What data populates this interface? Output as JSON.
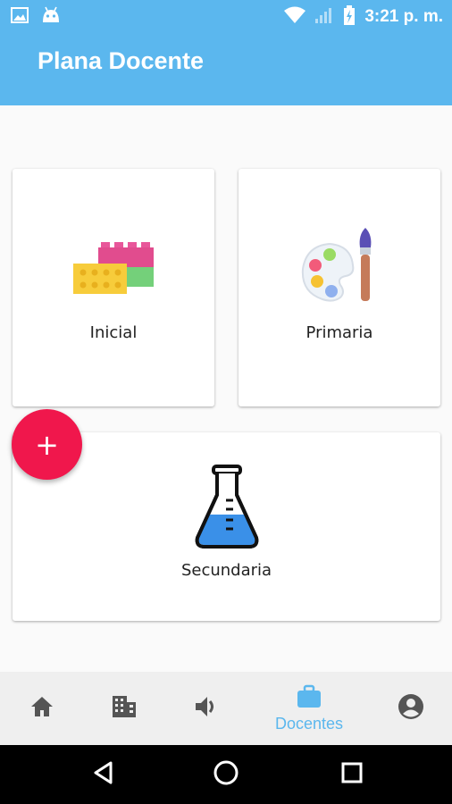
{
  "status_bar": {
    "time": "3:21 p. m.",
    "icons": [
      "image-icon",
      "android-icon",
      "wifi-icon",
      "signal-icon",
      "battery-charging-icon"
    ]
  },
  "app_bar": {
    "title": "Plana Docente"
  },
  "levels": [
    {
      "label": "Inicial",
      "icon": "lego-blocks-icon"
    },
    {
      "label": "Primaria",
      "icon": "paint-palette-icon"
    },
    {
      "label": "Secundaria",
      "icon": "flask-icon"
    }
  ],
  "fab": {
    "label": "+",
    "icon": "add-icon"
  },
  "bottom_nav": {
    "items": [
      {
        "icon": "home-icon",
        "label": ""
      },
      {
        "icon": "building-icon",
        "label": ""
      },
      {
        "icon": "volume-icon",
        "label": ""
      },
      {
        "icon": "briefcase-icon",
        "label": "Docentes",
        "active": true
      },
      {
        "icon": "account-icon",
        "label": ""
      }
    ]
  },
  "system_nav": [
    "back-icon",
    "home-circle-icon",
    "recents-icon"
  ],
  "colors": {
    "primary": "#5bb7ee",
    "accent": "#f0174c",
    "nav_background": "#efefef",
    "inactive_icon": "#555555"
  }
}
